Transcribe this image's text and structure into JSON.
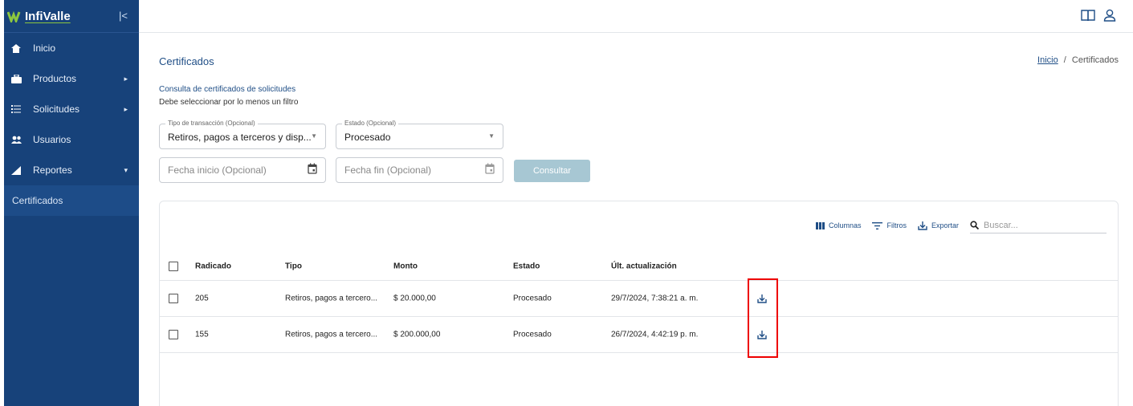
{
  "brand": {
    "name": "InfiValle"
  },
  "sidebar": {
    "collapse_glyph": "|<",
    "items": [
      {
        "label": "Inicio",
        "icon": "home-icon"
      },
      {
        "label": "Productos",
        "icon": "briefcase-icon",
        "has_children": true
      },
      {
        "label": "Solicitudes",
        "icon": "list-icon",
        "has_children": true
      },
      {
        "label": "Usuarios",
        "icon": "users-icon"
      },
      {
        "label": "Reportes",
        "icon": "chart-icon",
        "expanded": true
      }
    ],
    "sub_items": [
      {
        "label": "Certificados"
      }
    ]
  },
  "header": {
    "icons": [
      "book-icon",
      "user-icon"
    ]
  },
  "page": {
    "title": "Certificados",
    "breadcrumb": {
      "home": "Inicio",
      "separator": "/",
      "current": "Certificados"
    },
    "subhead": "Consulta de certificados de solicitudes",
    "note": "Debe seleccionar por lo menos un filtro"
  },
  "filters": {
    "transaction": {
      "legend": "Tipo de transacción (Opcional)",
      "value": "Retiros, pagos a terceros y disp..."
    },
    "status": {
      "legend": "Estado (Opcional)",
      "value": "Procesado"
    },
    "start_date": {
      "placeholder": "Fecha inicio (Opcional)"
    },
    "end_date": {
      "placeholder": "Fecha fin (Opcional)"
    },
    "submit_label": "Consultar"
  },
  "toolbar": {
    "columns_label": "Columnas",
    "filters_label": "Filtros",
    "export_label": "Exportar",
    "search_placeholder": "Buscar..."
  },
  "table": {
    "headers": [
      "Radicado",
      "Tipo",
      "Monto",
      "Estado",
      "Últ. actualización"
    ],
    "rows": [
      {
        "radicado": "205",
        "tipo": "Retiros, pagos a tercero...",
        "monto": "$ 20.000,00",
        "estado": "Procesado",
        "fecha": "29/7/2024, 7:38:21 a. m."
      },
      {
        "radicado": "155",
        "tipo": "Retiros, pagos a tercero...",
        "monto": "$ 200.000,00",
        "estado": "Procesado",
        "fecha": "26/7/2024, 4:42:19 p. m."
      }
    ]
  },
  "colors": {
    "sidebar": "#17427a",
    "accent": "#1f4e86",
    "button": "#a7c7d3",
    "highlight": "#e00000",
    "brand_green": "#8cc63f"
  }
}
